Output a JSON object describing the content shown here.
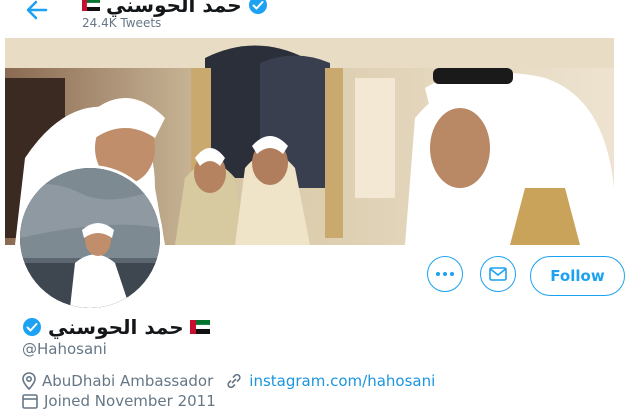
{
  "header": {
    "display_name": "حمد الحوسني",
    "tweet_count": "24.4K Tweets"
  },
  "profile": {
    "display_name": "حمد الحوسني",
    "handle": "@Hahosani",
    "location": "AbuDhabi Ambassador",
    "website": "instagram.com/hahosani",
    "joined": "Joined November 2011"
  },
  "actions": {
    "follow_label": "Follow",
    "more_icon": "more-icon",
    "message_icon": "envelope-icon"
  },
  "colors": {
    "accent": "#1da1f2",
    "link": "#1b95e0",
    "muted": "#657786",
    "verified": "#1da1f2"
  }
}
